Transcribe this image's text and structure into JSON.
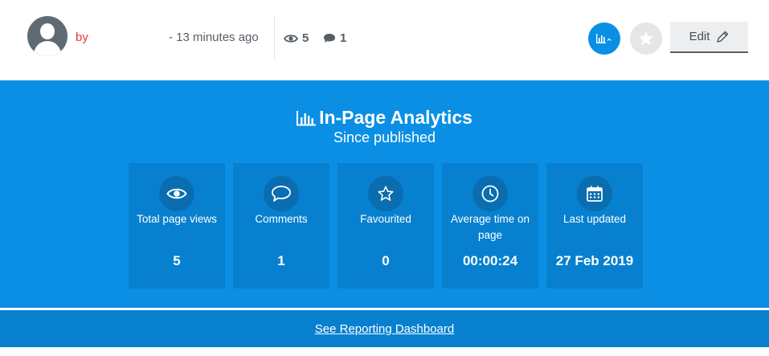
{
  "header": {
    "by_label": "by",
    "time_ago": "- 13 minutes ago",
    "views_count": "5",
    "comments_count": "1",
    "edit_label": "Edit"
  },
  "panel": {
    "title": "In-Page Analytics",
    "subtitle": "Since published"
  },
  "cards": [
    {
      "icon": "eye-icon",
      "label": "Total page views",
      "value": "5"
    },
    {
      "icon": "speech-bubble-icon",
      "label": "Comments",
      "value": "1"
    },
    {
      "icon": "star-icon",
      "label": "Favourited",
      "value": "0"
    },
    {
      "icon": "clock-icon",
      "label": "Average time on page",
      "value": "00:00:24"
    },
    {
      "icon": "calendar-icon",
      "label": "Last updated",
      "value": "27 Feb 2019"
    }
  ],
  "footer": {
    "link_label": "See Reporting Dashboard"
  },
  "colors": {
    "accent": "#0a8fe4",
    "card_bg": "#0780cf",
    "author_red": "#e53935"
  }
}
